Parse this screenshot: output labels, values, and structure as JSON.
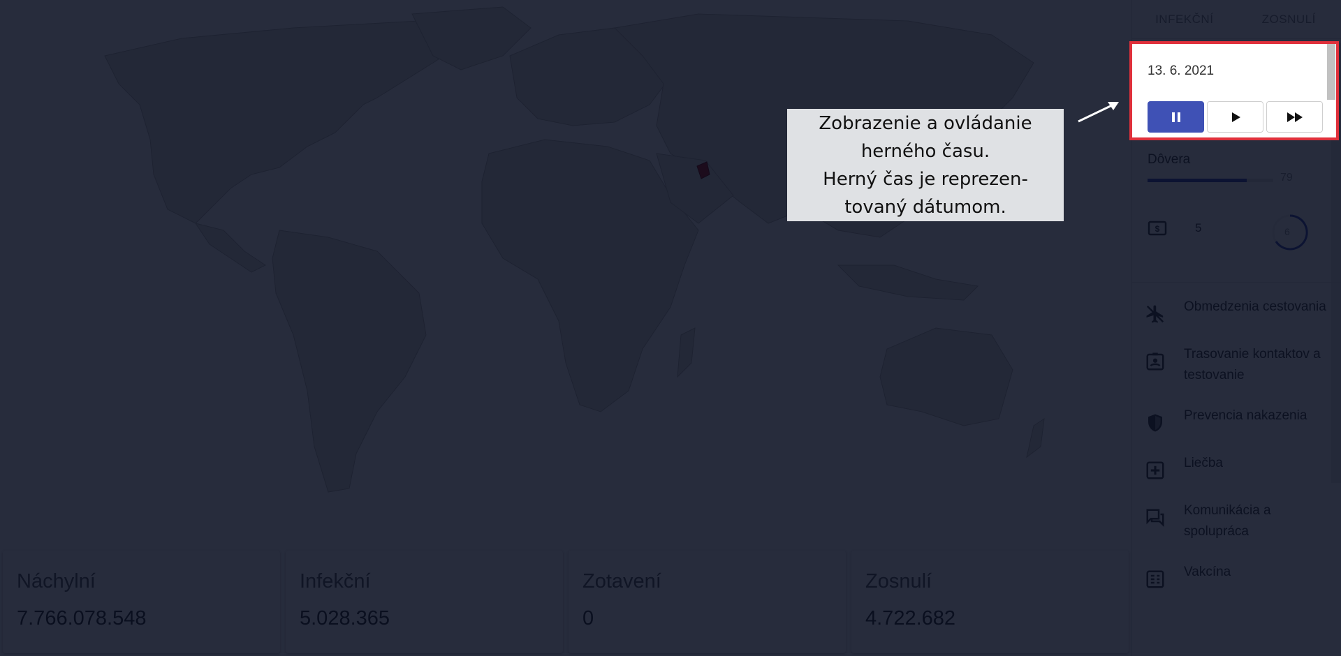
{
  "tabs": [
    "INFEKČNÍ",
    "ZOSNULÍ"
  ],
  "time": {
    "date": "13. 6. 2021",
    "buttons": [
      {
        "name": "pause",
        "active": true
      },
      {
        "name": "play",
        "active": false
      },
      {
        "name": "fast-forward",
        "active": false
      }
    ]
  },
  "trust": {
    "label": "Dôvera",
    "value": "79",
    "fraction": 0.79
  },
  "money": {
    "value": "5",
    "icon": "money-icon"
  },
  "spinner": {
    "value": "6",
    "icon": "progress-ring"
  },
  "measures": [
    {
      "label": "Obmedzenia cestovania",
      "icon": "airplane-off-icon"
    },
    {
      "label": "Trasovanie kontaktov a testovanie",
      "icon": "badge-icon"
    },
    {
      "label": "Prevencia nakazenia",
      "icon": "shield-icon"
    },
    {
      "label": "Liečba",
      "icon": "medical-plus-icon"
    },
    {
      "label": "Komunikácia a spolupráca",
      "icon": "forum-icon"
    },
    {
      "label": "Vakcína",
      "icon": "vaccine-icon"
    }
  ],
  "stats": [
    {
      "title": "Náchylní",
      "value": "7.766.078.548"
    },
    {
      "title": "Infekční",
      "value": "5.028.365"
    },
    {
      "title": "Zotavení",
      "value": "0"
    },
    {
      "title": "Zosnulí",
      "value": "4.722.682"
    }
  ],
  "callout": {
    "lines": [
      "Zobrazenie a ovládanie",
      "herného času.",
      "Herný čas je reprezen-",
      "tovaný dátumom."
    ]
  },
  "colors": {
    "accent": "#3f51b5",
    "highlight": "#e0303b",
    "infected_country": "#b02020"
  }
}
